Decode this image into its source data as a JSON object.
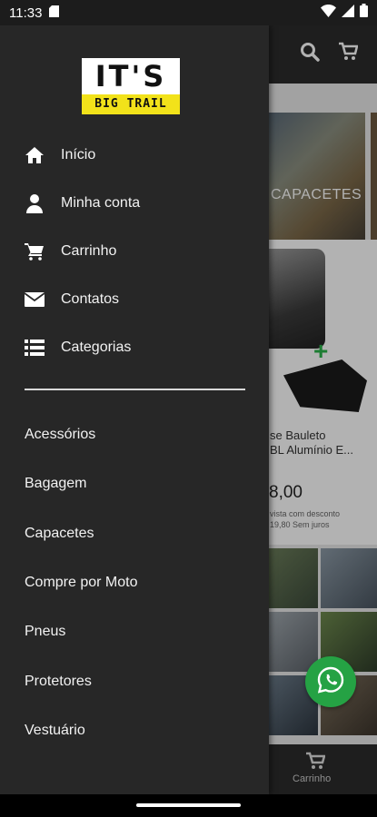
{
  "status_bar": {
    "time": "11:33"
  },
  "drawer": {
    "logo": {
      "line1": "IT'S",
      "line2": "BIG TRAIL"
    },
    "menu": [
      {
        "label": "Início",
        "icon": "home-icon"
      },
      {
        "label": "Minha conta",
        "icon": "user-icon"
      },
      {
        "label": "Carrinho",
        "icon": "cart-icon"
      },
      {
        "label": "Contatos",
        "icon": "envelope-icon"
      },
      {
        "label": "Categorias",
        "icon": "list-icon"
      }
    ],
    "categories": [
      "Acessórios",
      "Bagagem",
      "Capacetes",
      "Compre por Moto",
      "Pneus",
      "Protetores",
      "Vestuário"
    ]
  },
  "background": {
    "banner_label": "CAPACETES",
    "product": {
      "name_line1": "se Bauleto",
      "name_line2": "BL  Alumínio E...",
      "price": "8,00",
      "sub_line1": "vista com desconto",
      "sub_line2": "19,80 Sem juros"
    },
    "bottom_nav_cart": "Carrinho"
  },
  "colors": {
    "drawer_bg": "#272727",
    "logo_yellow": "#f2e21a",
    "whatsapp_green": "#25a244"
  }
}
